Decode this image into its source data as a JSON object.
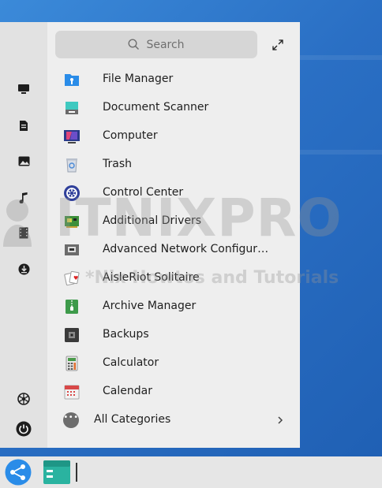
{
  "search": {
    "placeholder": "Search"
  },
  "sidebar": {
    "items": [
      {
        "icon": "computer-icon"
      },
      {
        "icon": "document-icon"
      },
      {
        "icon": "pictures-icon"
      },
      {
        "icon": "music-icon"
      },
      {
        "icon": "video-icon"
      },
      {
        "icon": "downloads-icon"
      }
    ],
    "bottom": [
      {
        "icon": "settings-icon"
      },
      {
        "icon": "power-icon"
      }
    ]
  },
  "apps": [
    {
      "label": "File Manager",
      "icon": "file-manager-icon"
    },
    {
      "label": "Document Scanner",
      "icon": "scanner-icon"
    },
    {
      "label": "Computer",
      "icon": "computer-app-icon"
    },
    {
      "label": "Trash",
      "icon": "trash-icon"
    },
    {
      "label": "Control Center",
      "icon": "control-center-icon"
    },
    {
      "label": "Additional Drivers",
      "icon": "drivers-icon"
    },
    {
      "label": "Advanced Network Configurati...",
      "icon": "network-icon"
    },
    {
      "label": "AisleRiot Solitaire",
      "icon": "cards-icon"
    },
    {
      "label": "Archive Manager",
      "icon": "archive-icon"
    },
    {
      "label": "Backups",
      "icon": "backups-icon"
    },
    {
      "label": "Calculator",
      "icon": "calculator-icon"
    },
    {
      "label": "Calendar",
      "icon": "calendar-icon"
    }
  ],
  "all_categories": {
    "label": "All Categories"
  },
  "watermark": {
    "title": "ITNIXPRO",
    "subtitle": "*Nix Howtos and Tutorials"
  },
  "taskbar": {
    "items": [
      {
        "icon": "start-menu-icon"
      },
      {
        "icon": "files-taskbar-icon"
      }
    ]
  },
  "colors": {
    "accent": "#2a8ce8",
    "menu_bg": "#eeeeee",
    "sidebar_bg": "#e2e2e2",
    "search_bg": "#d6d6d6"
  }
}
